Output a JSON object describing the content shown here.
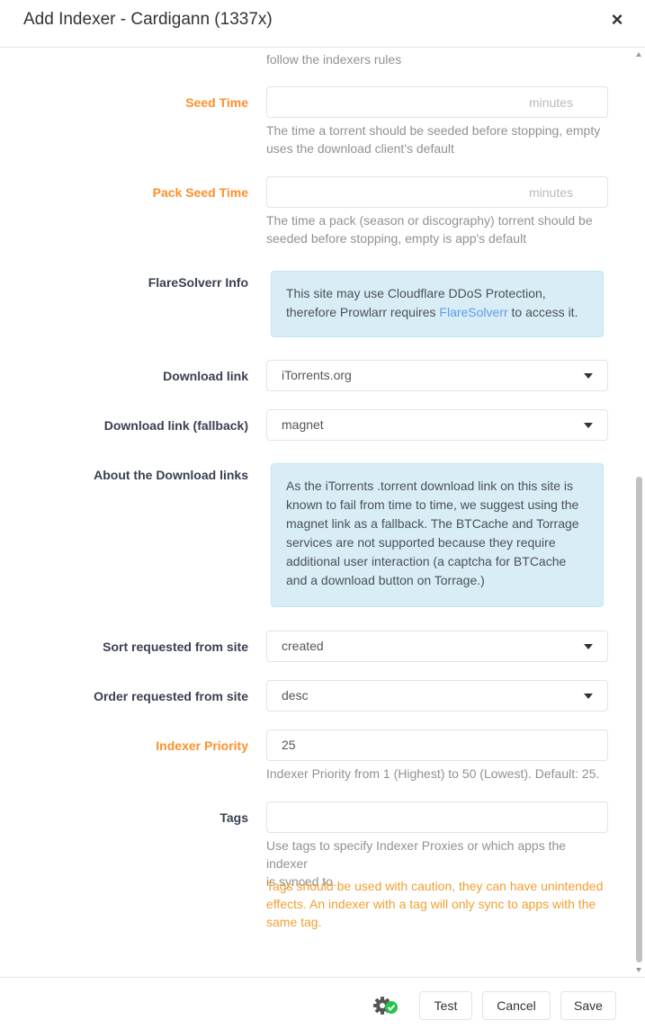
{
  "modal": {
    "title": "Add Indexer - Cardigann (1337x)",
    "close_label": "×"
  },
  "form": {
    "top_help_tail": "follow the indexers rules",
    "seed_time": {
      "label": "Seed Time",
      "unit": "minutes",
      "value": "",
      "help_lines": [
        "The time a torrent should be seeded before stopping, empty",
        "uses the download client's default"
      ]
    },
    "pack_seed_time": {
      "label": "Pack Seed Time",
      "unit": "minutes",
      "value": "",
      "help_lines": [
        "The time a pack (season or discography) torrent should be",
        "seeded before stopping, empty is app's default"
      ]
    },
    "flaresolverr": {
      "label": "FlareSolverr Info",
      "line1": "This site may use Cloudflare DDoS Protection,",
      "line2_prefix": "therefore Prowlarr requires ",
      "link": "FlareSolverr",
      "line2_suffix": " to access it."
    },
    "download_link": {
      "label": "Download link",
      "value": "iTorrents.org"
    },
    "download_link_fallback": {
      "label": "Download link (fallback)",
      "value": "magnet"
    },
    "about_download_links": {
      "label": "About the Download links",
      "lines": [
        "As the iTorrents .torrent download link on this site is",
        "known to fail from time to time, we suggest using the",
        "magnet link as a fallback. The BTCache and Torrage",
        "services are not supported because they require",
        "additional user interaction (a captcha for BTCache",
        "and a download button on Torrage.)"
      ]
    },
    "sort": {
      "label": "Sort requested from site",
      "value": "created"
    },
    "order": {
      "label": "Order requested from site",
      "value": "desc"
    },
    "indexer_priority": {
      "label": "Indexer Priority",
      "value": "25",
      "help": "Indexer Priority from 1 (Highest) to 50 (Lowest). Default: 25."
    },
    "tags": {
      "label": "Tags",
      "value": "",
      "help_lines": [
        "Use tags to specify Indexer Proxies or which apps the indexer",
        "is synced to."
      ],
      "warning_lines": [
        "Tags should be used with caution, they can have unintended",
        "effects. An indexer with a tag will only sync to apps with the",
        "same tag."
      ]
    }
  },
  "footer": {
    "advanced_icon": "gear-check-icon",
    "test_label": "Test",
    "cancel_label": "Cancel",
    "save_label": "Save"
  },
  "colors": {
    "advanced_label": "#ff902b",
    "warning_text": "#f0a030",
    "info_alert_bg": "#d9edf7",
    "link": "#5d9cec"
  }
}
